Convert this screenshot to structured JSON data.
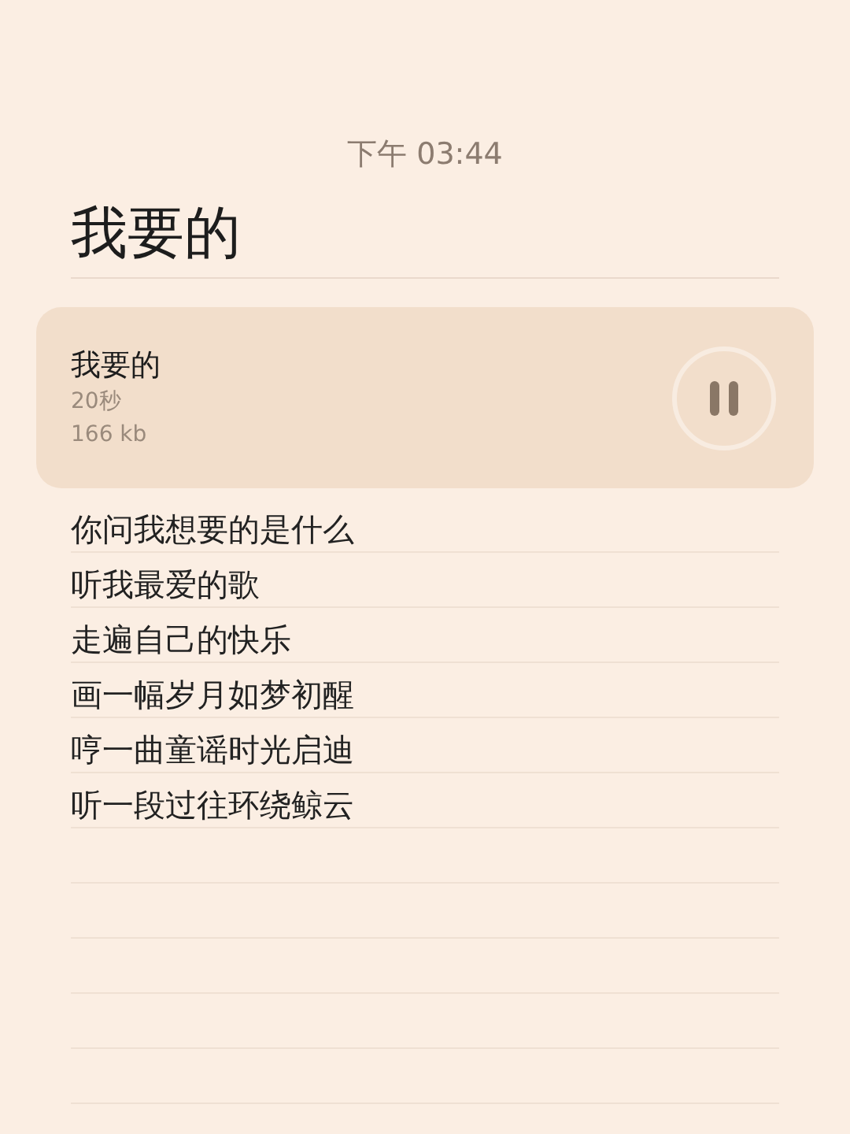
{
  "time": "下午 03:44",
  "title": "我要的",
  "audio": {
    "name": "我要的",
    "duration": "20秒",
    "size": "166 kb",
    "playing": true
  },
  "lines": [
    "你问我想要的是什么",
    "听我最爱的歌",
    "走遍自己的快乐",
    "画一幅岁月如梦初醒",
    "哼一曲童谣时光启迪",
    "听一段过往环绕鲸云"
  ]
}
